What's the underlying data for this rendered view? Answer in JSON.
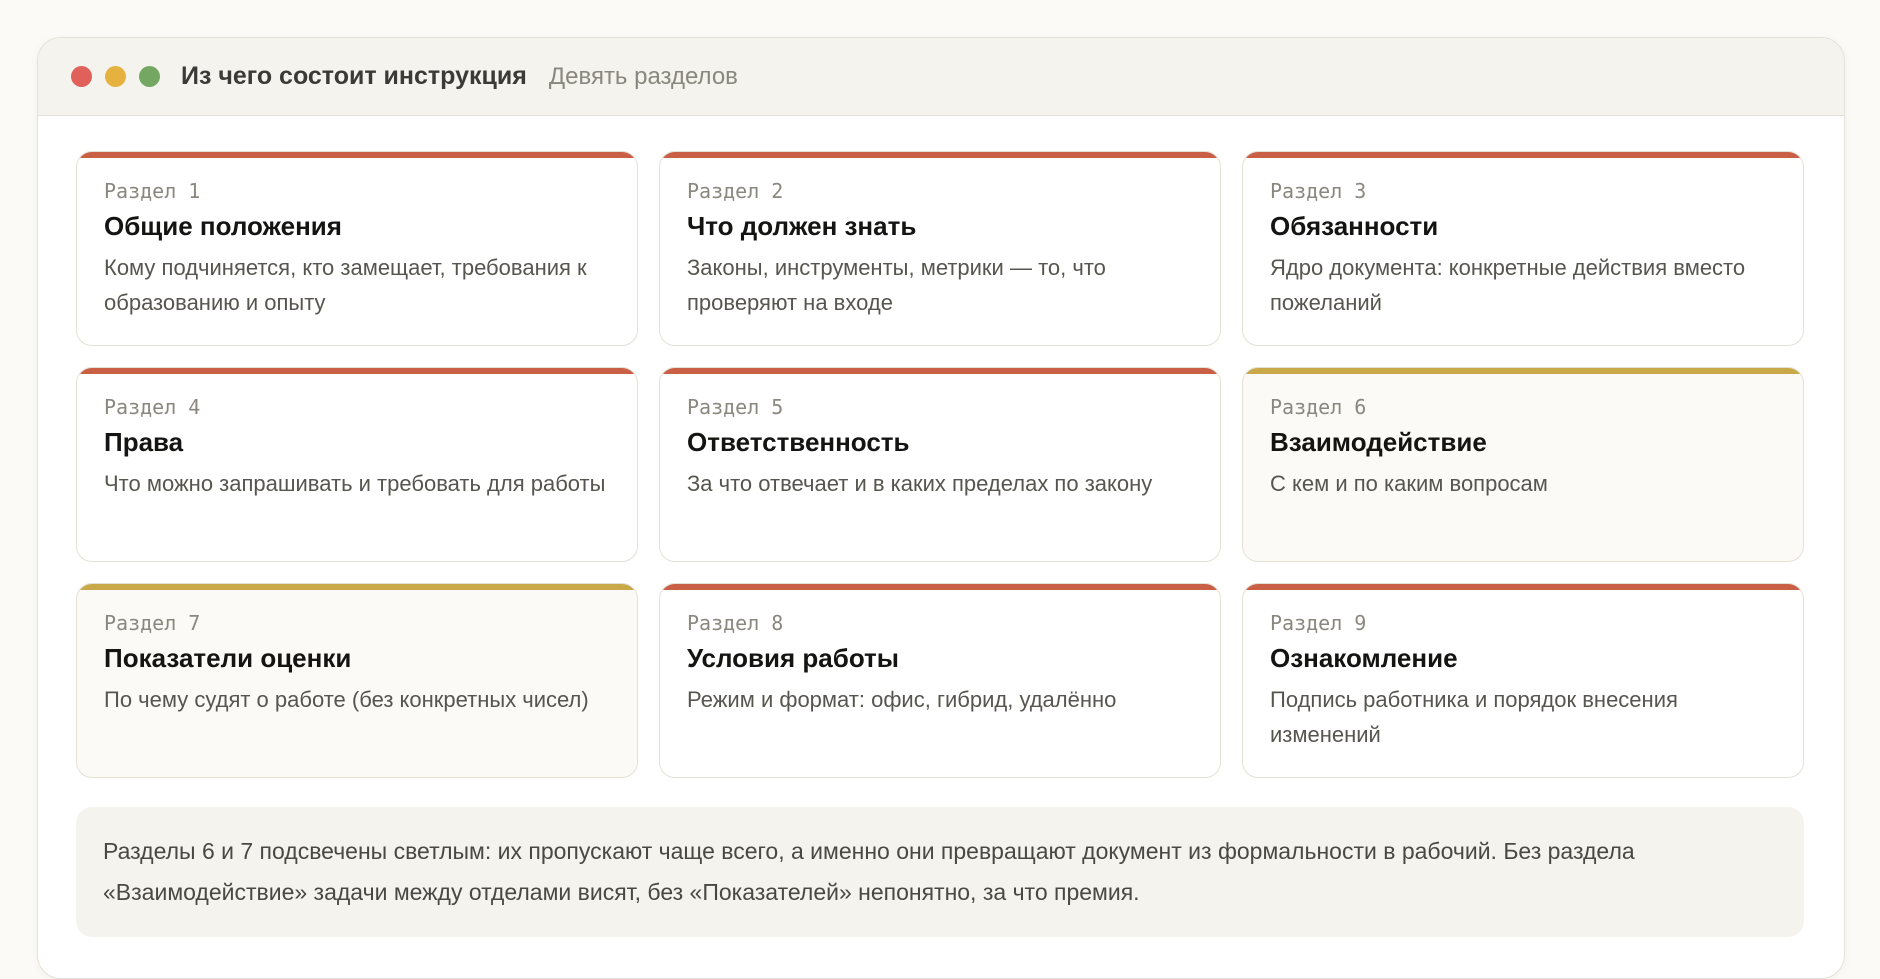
{
  "window": {
    "title": "Из чего состоит инструкция",
    "subtitle": "Девять разделов",
    "controls": [
      {
        "name": "close-window-button",
        "color": "#e0605a"
      },
      {
        "name": "minimize-window-button",
        "color": "#e6b23f"
      },
      {
        "name": "maximize-window-button",
        "color": "#74a862"
      }
    ]
  },
  "colors": {
    "accent": "#c95f45",
    "highlight_accent": "#c9a849"
  },
  "sections": [
    {
      "number": "Раздел 1",
      "title": "Общие положения",
      "description": "Кому подчиняется, кто замещает, требования к образованию и опыту",
      "highlighted": false
    },
    {
      "number": "Раздел 2",
      "title": "Что должен знать",
      "description": "Законы, инструменты, метрики — то, что проверяют на входе",
      "highlighted": false
    },
    {
      "number": "Раздел 3",
      "title": "Обязанности",
      "description": "Ядро документа: конкретные действия вместо пожеланий",
      "highlighted": false
    },
    {
      "number": "Раздел 4",
      "title": "Права",
      "description": "Что можно запрашивать и требовать для работы",
      "highlighted": false
    },
    {
      "number": "Раздел 5",
      "title": "Ответственность",
      "description": "За что отвечает и в каких пределах по закону",
      "highlighted": false
    },
    {
      "number": "Раздел 6",
      "title": "Взаимодействие",
      "description": "С кем и по каким вопросам",
      "highlighted": true
    },
    {
      "number": "Раздел 7",
      "title": "Показатели оценки",
      "description": "По чему судят о работе (без конкретных чисел)",
      "highlighted": true
    },
    {
      "number": "Раздел 8",
      "title": "Условия работы",
      "description": "Режим и формат: офис, гибрид, удалённо",
      "highlighted": false
    },
    {
      "number": "Раздел 9",
      "title": "Ознакомление",
      "description": "Подпись работника и порядок внесения изменений",
      "highlighted": false
    }
  ],
  "note": "Разделы 6 и 7 подсвечены светлым: их пропускают чаще всего, а именно они превращают документ из формальности в рабочий. Без раздела «Взаимодействие» задачи между отделами висят, без «Показателей» непонятно, за что премия."
}
